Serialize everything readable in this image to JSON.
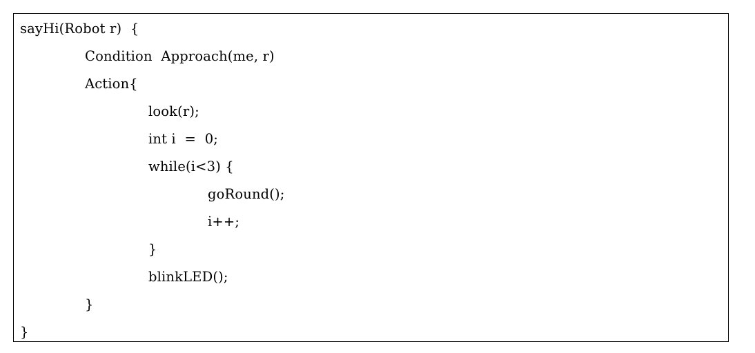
{
  "figure": {
    "kind": "code-listing",
    "background_color": "#ffffff",
    "text_color": "#000000",
    "border_color": "#000000"
  },
  "code": {
    "language": "robot-behavior-pseudocode",
    "lines": [
      {
        "text": "sayHi(Robot r)  {",
        "indent": 0
      },
      {
        "text": "Condition  Approach(me, r)",
        "indent": 1
      },
      {
        "text": "Action{",
        "indent": 1
      },
      {
        "text": "look(r);",
        "indent": 2
      },
      {
        "text": "int i  =  0;",
        "indent": 2
      },
      {
        "text": "while(i<3) {",
        "indent": 2
      },
      {
        "text": "goRound();",
        "indent": 3
      },
      {
        "text": "i++;",
        "indent": 3
      },
      {
        "text": "}",
        "indent": 2
      },
      {
        "text": "blinkLED();",
        "indent": 2
      },
      {
        "text": "}",
        "indent": 1
      },
      {
        "text": "}",
        "indent": 0
      }
    ]
  }
}
